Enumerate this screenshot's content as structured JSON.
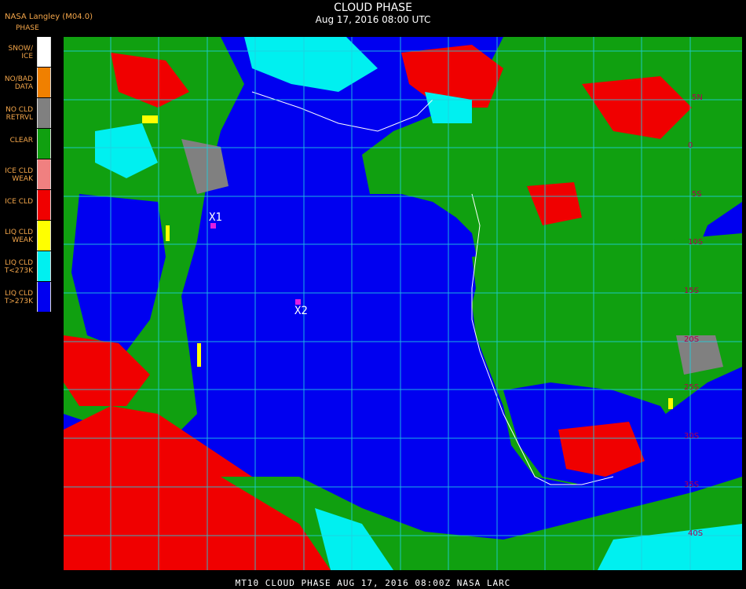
{
  "header": {
    "title": "CLOUD PHASE",
    "date": "Aug 17, 2016 08:00 UTC",
    "source": "NASA Langley (M04.0)"
  },
  "legend": {
    "title": "PHASE",
    "items": [
      {
        "label": "SNOW/\nICE",
        "color": "#ffffff"
      },
      {
        "label": "NO/BAD\nDATA",
        "color": "#f08000"
      },
      {
        "label": "NO CLD\nRETRVL",
        "color": "#808080"
      },
      {
        "label": "CLEAR",
        "color": "#10a010"
      },
      {
        "label": "ICE CLD\nWEAK",
        "color": "#f08080"
      },
      {
        "label": "ICE CLD",
        "color": "#f00000"
      },
      {
        "label": "LIQ CLD\nWEAK",
        "color": "#ffff00"
      },
      {
        "label": "LIQ CLD\nT<273K",
        "color": "#00f0f0"
      },
      {
        "label": "LIQ CLD\nT>273K",
        "color": "#0000f0"
      }
    ]
  },
  "markers": [
    {
      "label": "X1"
    },
    {
      "label": "X2"
    }
  ],
  "lat_labels": [
    "5N",
    "0",
    "5S",
    "10S",
    "15S",
    "20S",
    "25S",
    "30S",
    "35S",
    "40S"
  ],
  "footer": "MT10  CLOUD PHASE   AUG 17, 2016 08:00Z   NASA LARC"
}
